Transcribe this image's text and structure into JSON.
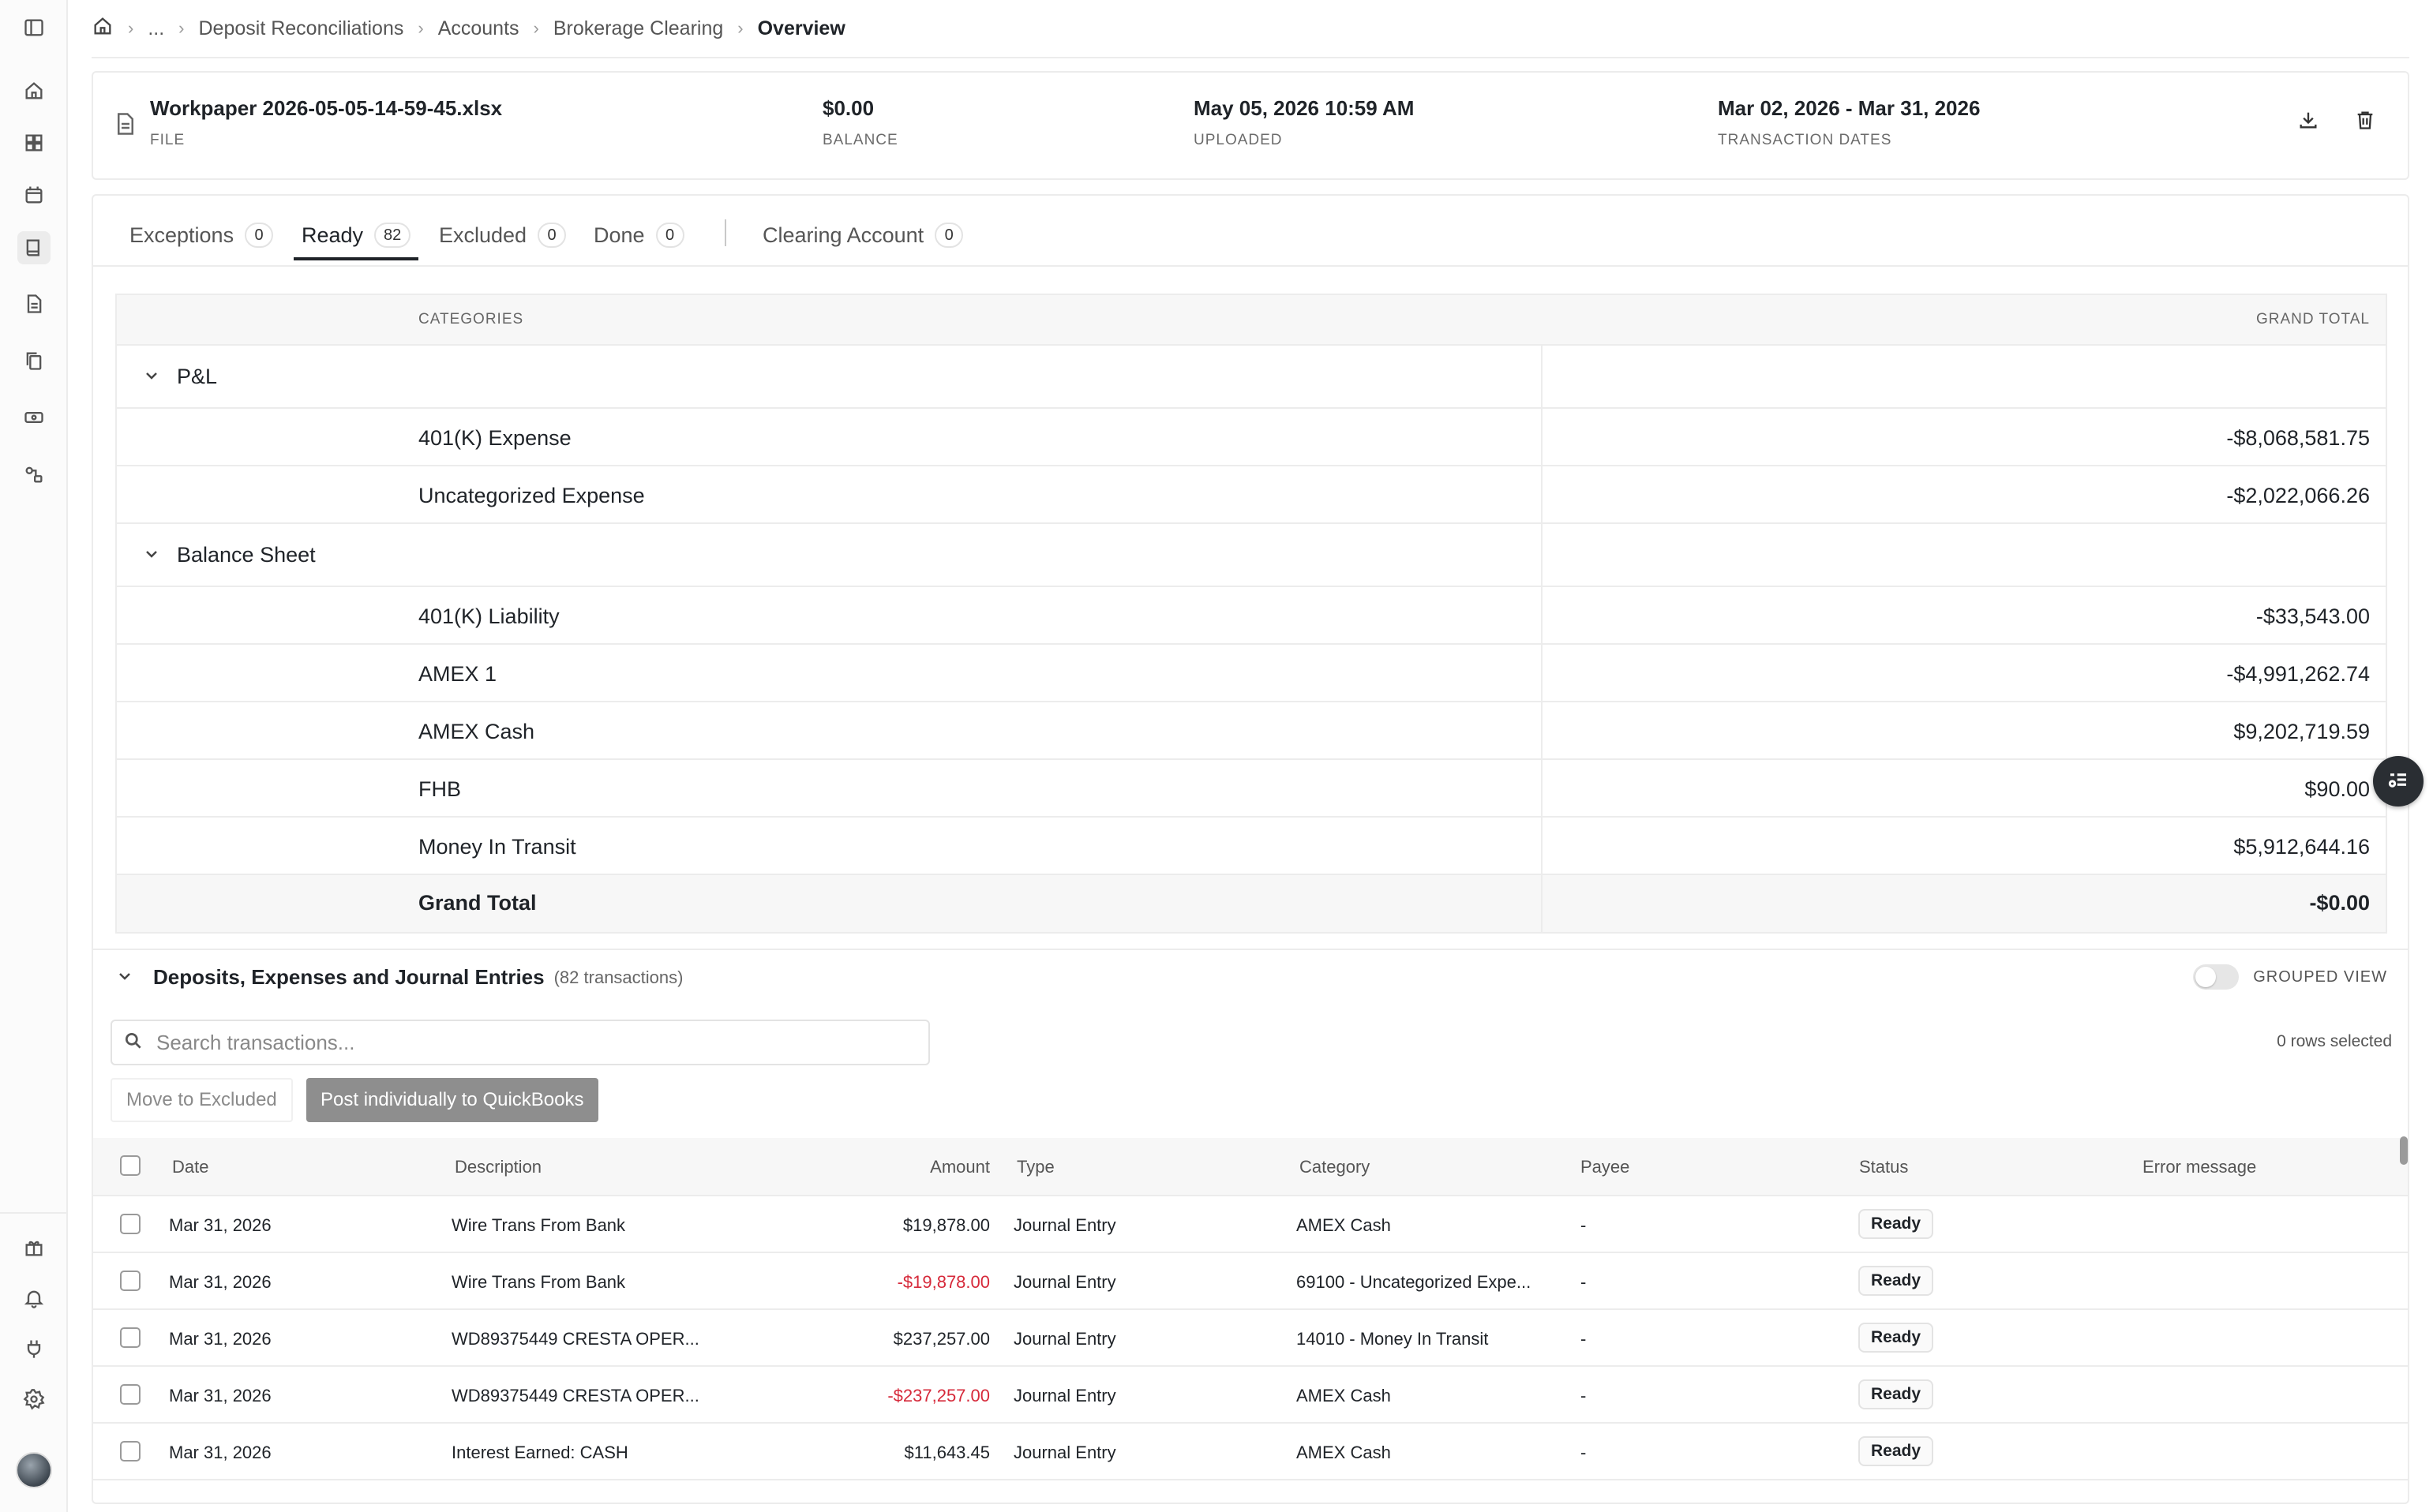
{
  "sidebar": {
    "icons": [
      "panel-toggle-icon",
      "home-icon",
      "dashboard-icon",
      "calendar-icon",
      "book-icon",
      "document-icon",
      "copy-icon",
      "cash-icon",
      "connections-icon",
      "gift-icon",
      "bell-icon",
      "plug-icon",
      "settings-icon"
    ]
  },
  "breadcrumb": {
    "ellipsis": "...",
    "items": [
      "Deposit Reconciliations",
      "Accounts",
      "Brokerage Clearing"
    ],
    "current": "Overview"
  },
  "file": {
    "name": "Workpaper 2026-05-05-14-59-45.xlsx",
    "name_label": "FILE",
    "balance": "$0.00",
    "balance_label": "BALANCE",
    "uploaded": "May 05, 2026 10:59 AM",
    "uploaded_label": "UPLOADED",
    "dates": "Mar 02, 2026 - Mar 31, 2026",
    "dates_label": "TRANSACTION DATES"
  },
  "tabs": [
    {
      "label": "Exceptions",
      "count": "0"
    },
    {
      "label": "Ready",
      "count": "82"
    },
    {
      "label": "Excluded",
      "count": "0"
    },
    {
      "label": "Done",
      "count": "0"
    },
    {
      "label": "Clearing Account",
      "count": "0"
    }
  ],
  "categories": {
    "header_left": "CATEGORIES",
    "header_right": "GRAND TOTAL",
    "groups": [
      {
        "name": "P&L",
        "items": [
          {
            "name": "401(K) Expense",
            "total": "-$8,068,581.75"
          },
          {
            "name": "Uncategorized Expense",
            "total": "-$2,022,066.26"
          }
        ]
      },
      {
        "name": "Balance Sheet",
        "items": [
          {
            "name": "401(K) Liability",
            "total": "-$33,543.00"
          },
          {
            "name": "AMEX 1",
            "total": "-$4,991,262.74"
          },
          {
            "name": "AMEX Cash",
            "total": "$9,202,719.59"
          },
          {
            "name": "FHB",
            "total": "$90.00"
          },
          {
            "name": "Money In Transit",
            "total": "$5,912,644.16"
          }
        ]
      }
    ],
    "grand_total_label": "Grand Total",
    "grand_total": "-$0.00"
  },
  "transactions": {
    "title": "Deposits, Expenses and Journal Entries",
    "count": "(82 transactions)",
    "grouped_view_label": "GROUPED VIEW",
    "search_placeholder": "Search transactions...",
    "rows_selected": "0 rows selected",
    "move_button": "Move to Excluded",
    "post_button": "Post individually to QuickBooks",
    "columns": [
      "Date",
      "Description",
      "Amount",
      "Type",
      "Category",
      "Payee",
      "Status",
      "Error message"
    ],
    "rows": [
      {
        "date": "Mar 31, 2026",
        "description": "Wire Trans From Bank",
        "amount": "$19,878.00",
        "type": "Journal Entry",
        "category": "AMEX Cash",
        "payee": "-",
        "status": "Ready"
      },
      {
        "date": "Mar 31, 2026",
        "description": "Wire Trans From Bank",
        "amount": "-$19,878.00",
        "type": "Journal Entry",
        "category": "69100 - Uncategorized Expe...",
        "payee": "-",
        "status": "Ready"
      },
      {
        "date": "Mar 31, 2026",
        "description": "WD89375449 CRESTA OPER...",
        "amount": "$237,257.00",
        "type": "Journal Entry",
        "category": "14010 - Money In Transit",
        "payee": "-",
        "status": "Ready"
      },
      {
        "date": "Mar 31, 2026",
        "description": "WD89375449 CRESTA OPER...",
        "amount": "-$237,257.00",
        "type": "Journal Entry",
        "category": "AMEX Cash",
        "payee": "-",
        "status": "Ready"
      },
      {
        "date": "Mar 31, 2026",
        "description": "Interest Earned: CASH",
        "amount": "$11,643.45",
        "type": "Journal Entry",
        "category": "AMEX Cash",
        "payee": "-",
        "status": "Ready"
      }
    ]
  },
  "colors": {
    "negative": "#d6293a",
    "accent": "#1f2328"
  }
}
